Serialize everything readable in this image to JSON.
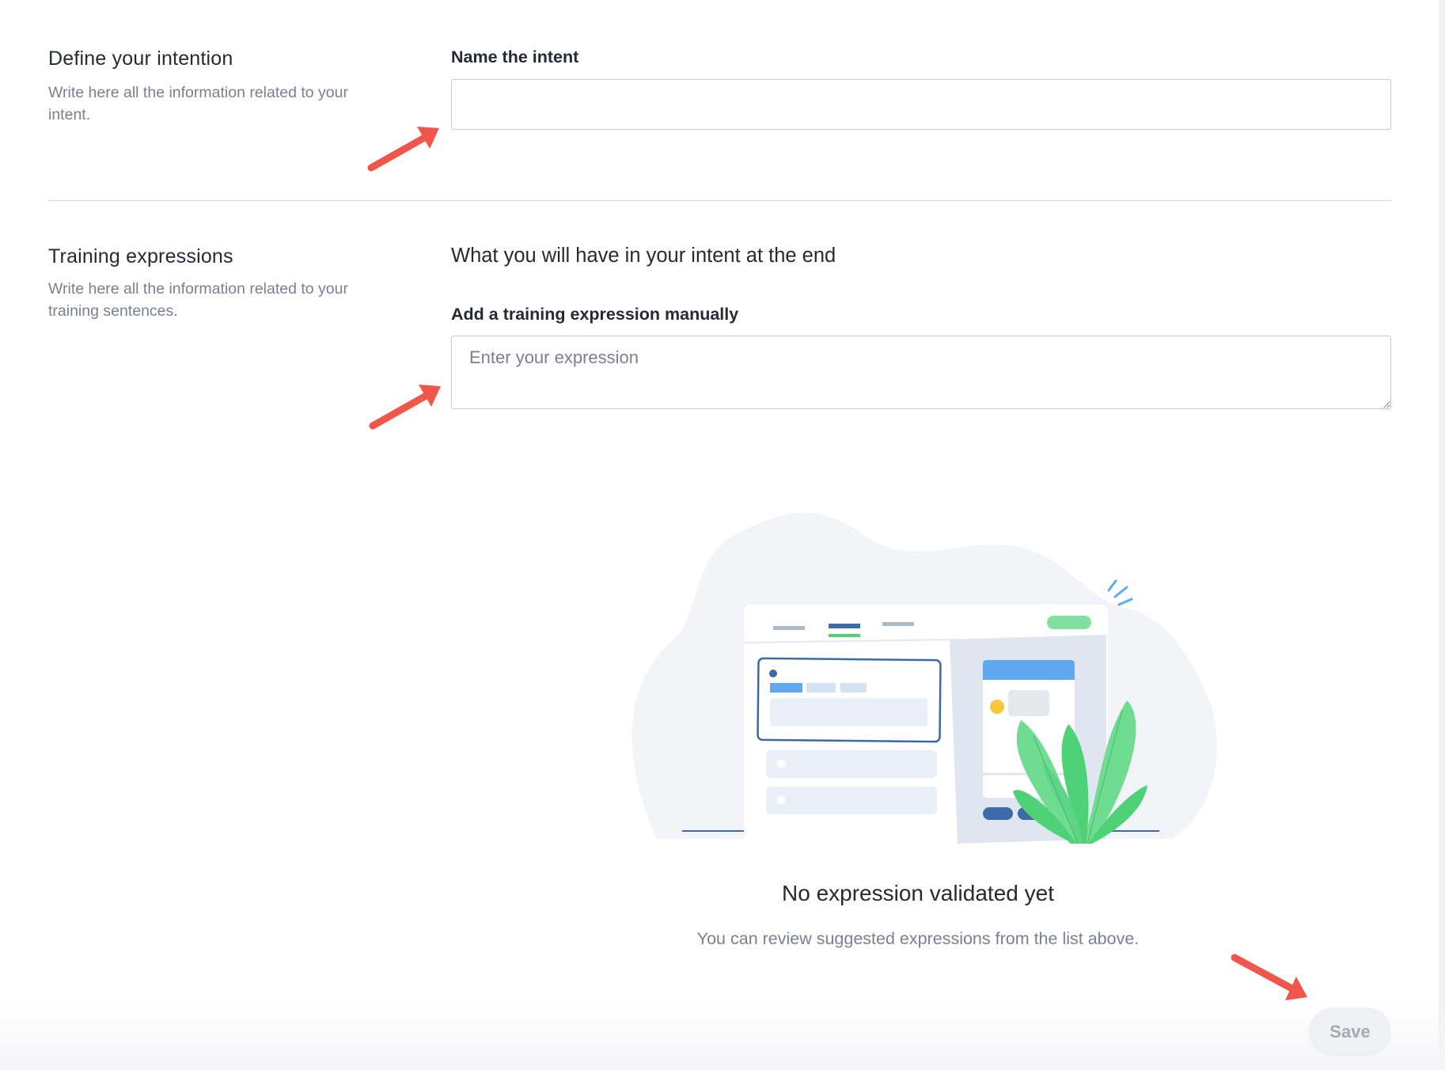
{
  "define_section": {
    "title": "Define your intention",
    "description": "Write here all the information related to your intent."
  },
  "name_field": {
    "label": "Name the intent",
    "value": "",
    "placeholder": ""
  },
  "training_section": {
    "title": "Training expressions",
    "description": "Write here all the information related to your training sentences."
  },
  "intent_summary": {
    "heading": "What you will have in your intent at the end"
  },
  "expression_field": {
    "label": "Add a training expression manually",
    "placeholder": "Enter your expression"
  },
  "empty_state": {
    "title": "No expression validated yet",
    "description": "You can review suggested expressions from the list above."
  },
  "actions": {
    "save_label": "Save"
  },
  "colors": {
    "annotation_arrow": "#f0574a",
    "illustration_blob": "#f3f4f7",
    "illustration_blue": "#3d6aa8",
    "illustration_light_blue": "#5ea9f0",
    "illustration_green": "#4fd178"
  }
}
